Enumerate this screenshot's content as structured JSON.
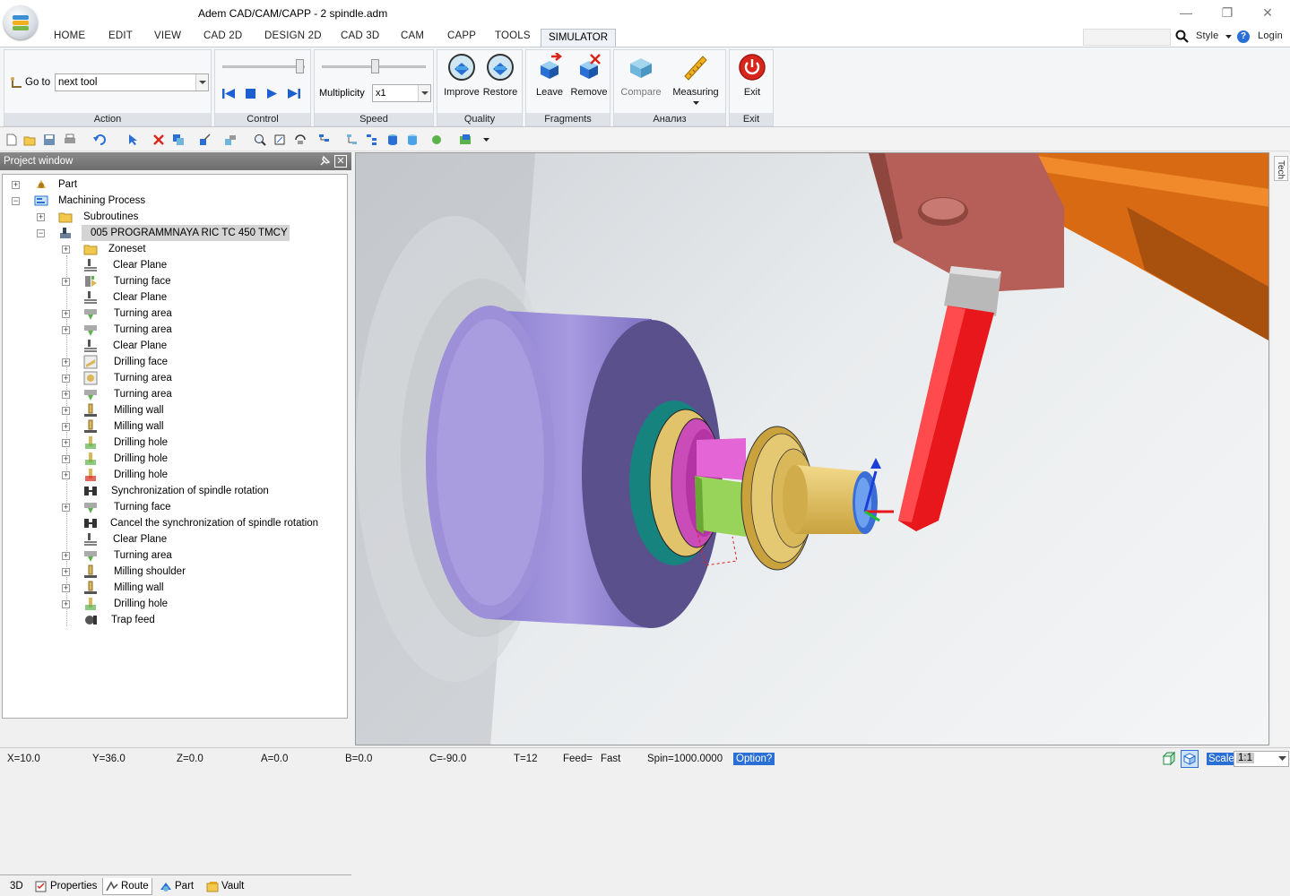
{
  "window": {
    "title": "Adem CAD/CAM/CAPP - 2 spindle.adm",
    "controls": {
      "minimize": "—",
      "restore": "❐",
      "close": "✕"
    }
  },
  "ribbon_tabs": [
    "HOME",
    "EDIT",
    "VIEW",
    "CAD 2D",
    "DESIGN 2D",
    "CAD 3D",
    "CAM",
    "CAPP",
    "TOOLS",
    "SIMULATOR"
  ],
  "active_tab": "SIMULATOR",
  "top_right": {
    "style_label": "Style",
    "login_label": "Login",
    "help_glyph": "?"
  },
  "ribbon": {
    "action": {
      "goto_label": "Go to",
      "goto_value": "next tool",
      "group_label": "Action"
    },
    "control": {
      "group_label": "Control"
    },
    "speed": {
      "multiplicity_label": "Multiplicity",
      "multiplicity_value": "x1",
      "group_label": "Speed"
    },
    "quality": {
      "improve_label": "Improve",
      "restore_label": "Restore",
      "group_label": "Quality"
    },
    "fragments": {
      "leave_label": "Leave",
      "remove_label": "Remove",
      "group_label": "Fragments"
    },
    "analysis": {
      "compare_label": "Compare",
      "measuring_label": "Measuring",
      "group_label": "Анализ"
    },
    "exit": {
      "exit_label": "Exit",
      "group_label": "Exit"
    }
  },
  "project_window": {
    "title": "Project window",
    "tree": [
      {
        "label": "Part"
      },
      {
        "label": "Machining Process"
      },
      {
        "label": "Subroutines"
      },
      {
        "label": "005  PROGRAMMNAYA RIC TC 450 TMCY"
      },
      {
        "label": "Zoneset"
      },
      {
        "label": "Clear Plane"
      },
      {
        "label": "Turning  face"
      },
      {
        "label": "Clear Plane"
      },
      {
        "label": "Turning  area"
      },
      {
        "label": "Turning  area"
      },
      {
        "label": "Clear Plane"
      },
      {
        "label": "Drilling  face"
      },
      {
        "label": "Turning  area"
      },
      {
        "label": "Turning  area"
      },
      {
        "label": "Milling  wall"
      },
      {
        "label": "Milling  wall"
      },
      {
        "label": "Drilling  hole"
      },
      {
        "label": "Drilling  hole"
      },
      {
        "label": "Drilling  hole"
      },
      {
        "label": "Synchronization of spindle rotation"
      },
      {
        "label": "Turning  face"
      },
      {
        "label": "Cancel the synchronization of spindle rotation"
      },
      {
        "label": "Clear Plane"
      },
      {
        "label": "Turning  area"
      },
      {
        "label": "Milling  shoulder"
      },
      {
        "label": "Milling  wall"
      },
      {
        "label": "Drilling  hole"
      },
      {
        "label": "Trap feed"
      }
    ],
    "bottom_tabs": [
      "3D",
      "Properties",
      "Route",
      "Part",
      "Vault"
    ]
  },
  "right_strip_label": "Tech",
  "status": {
    "x": "X=10.0",
    "y": "Y=36.0",
    "z": "Z=0.0",
    "a": "A=0.0",
    "b": "B=0.0",
    "c": "C=-90.0",
    "t": "T=12",
    "feed_label": "Feed=",
    "feed_value": "Fast",
    "spin": "Spin=1000.0000",
    "option": "Option?",
    "scale_label": "Scale",
    "scale_value": "1:1"
  },
  "colors": {
    "accent": "#2a6fd6",
    "tool_red": "#e8171b",
    "part_purple": "#9d8fd8",
    "part_gold": "#d9b85a",
    "holder_brown": "#b55f58",
    "arm_orange": "#d86a14"
  }
}
